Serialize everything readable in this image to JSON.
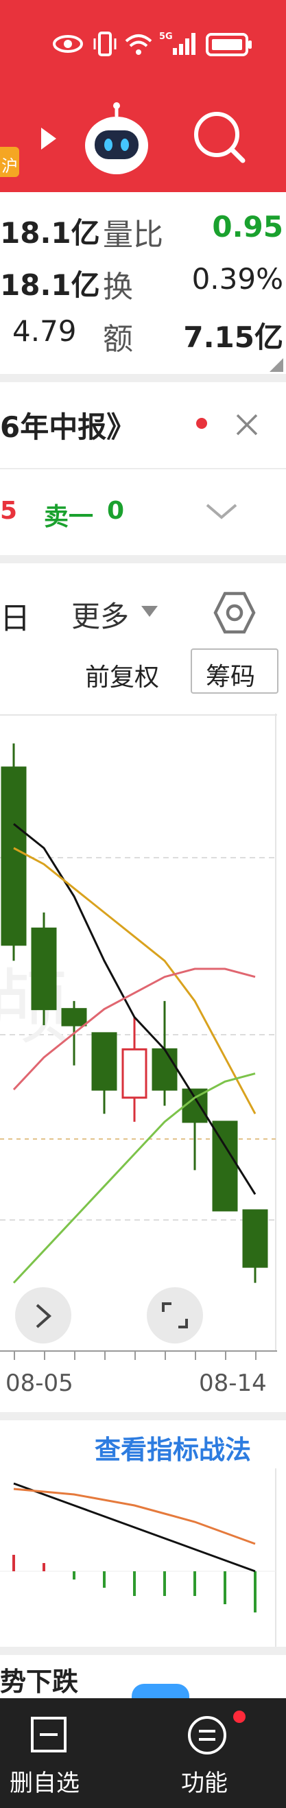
{
  "status": {
    "net_label": "5G"
  },
  "header": {
    "tag": "沪",
    "colors": {
      "brand": "#e8333c"
    }
  },
  "quote": {
    "row1": {
      "value": "18.1亿",
      "label": "量比",
      "value2": "0.95"
    },
    "row2": {
      "value": "18.1亿",
      "label": "换",
      "value2": "0.39%"
    },
    "row3": {
      "value": "4.79",
      "label": "额",
      "value2": "7.15亿"
    }
  },
  "notice": {
    "text": "6年中报》"
  },
  "order": {
    "left": "5",
    "sell_label": "卖一",
    "sell_value": "0"
  },
  "period_tabs": {
    "day": "日",
    "more": "更多"
  },
  "chart_controls": {
    "adjust": "前复权",
    "chips": "筹码"
  },
  "kline": {
    "x_ticks": [
      "08-05",
      "08-14"
    ],
    "candles": [
      {
        "open": 100,
        "close": 78,
        "high": 103,
        "low": 76,
        "dir": "down"
      },
      {
        "open": 80,
        "close": 70,
        "high": 82,
        "low": 68,
        "dir": "down"
      },
      {
        "open": 70,
        "close": 68,
        "high": 71,
        "low": 63,
        "dir": "down"
      },
      {
        "open": 67,
        "close": 60,
        "high": 67,
        "low": 57,
        "dir": "down"
      },
      {
        "open": 59,
        "close": 65,
        "high": 69,
        "low": 56,
        "dir": "up"
      },
      {
        "open": 65,
        "close": 60,
        "high": 71,
        "low": 58,
        "dir": "down"
      },
      {
        "open": 60,
        "close": 56,
        "high": 60,
        "low": 50,
        "dir": "down"
      },
      {
        "open": 56,
        "close": 45,
        "high": 56,
        "low": 45,
        "dir": "down"
      },
      {
        "open": 45,
        "close": 38,
        "high": 45,
        "low": 36,
        "dir": "down"
      }
    ],
    "ma_black": [
      93,
      90,
      84,
      76,
      69,
      65,
      59,
      53,
      47
    ],
    "ma_orange": [
      90,
      88,
      85,
      82,
      79,
      76,
      71,
      64,
      57
    ],
    "ma_red": [
      60,
      64,
      67,
      70,
      72,
      74,
      75,
      75,
      74
    ],
    "ma_green": [
      36,
      40,
      44,
      48,
      52,
      56,
      59,
      61,
      62
    ]
  },
  "indicator": {
    "link": "查看指标战法"
  },
  "macd": {
    "line_black": [
      52,
      48,
      44,
      40,
      36,
      32,
      28,
      24,
      20
    ],
    "line_orange": [
      50,
      49,
      48,
      46,
      44,
      41,
      38,
      34,
      30
    ],
    "bars": [
      2,
      1,
      -1,
      -2,
      -3,
      -3,
      -3,
      -4,
      -5
    ]
  },
  "news": {
    "headline": "势下跌"
  },
  "bottom": {
    "delete_label": "删自选",
    "function_label": "功能",
    "badge_color": "#ff2a3a"
  }
}
